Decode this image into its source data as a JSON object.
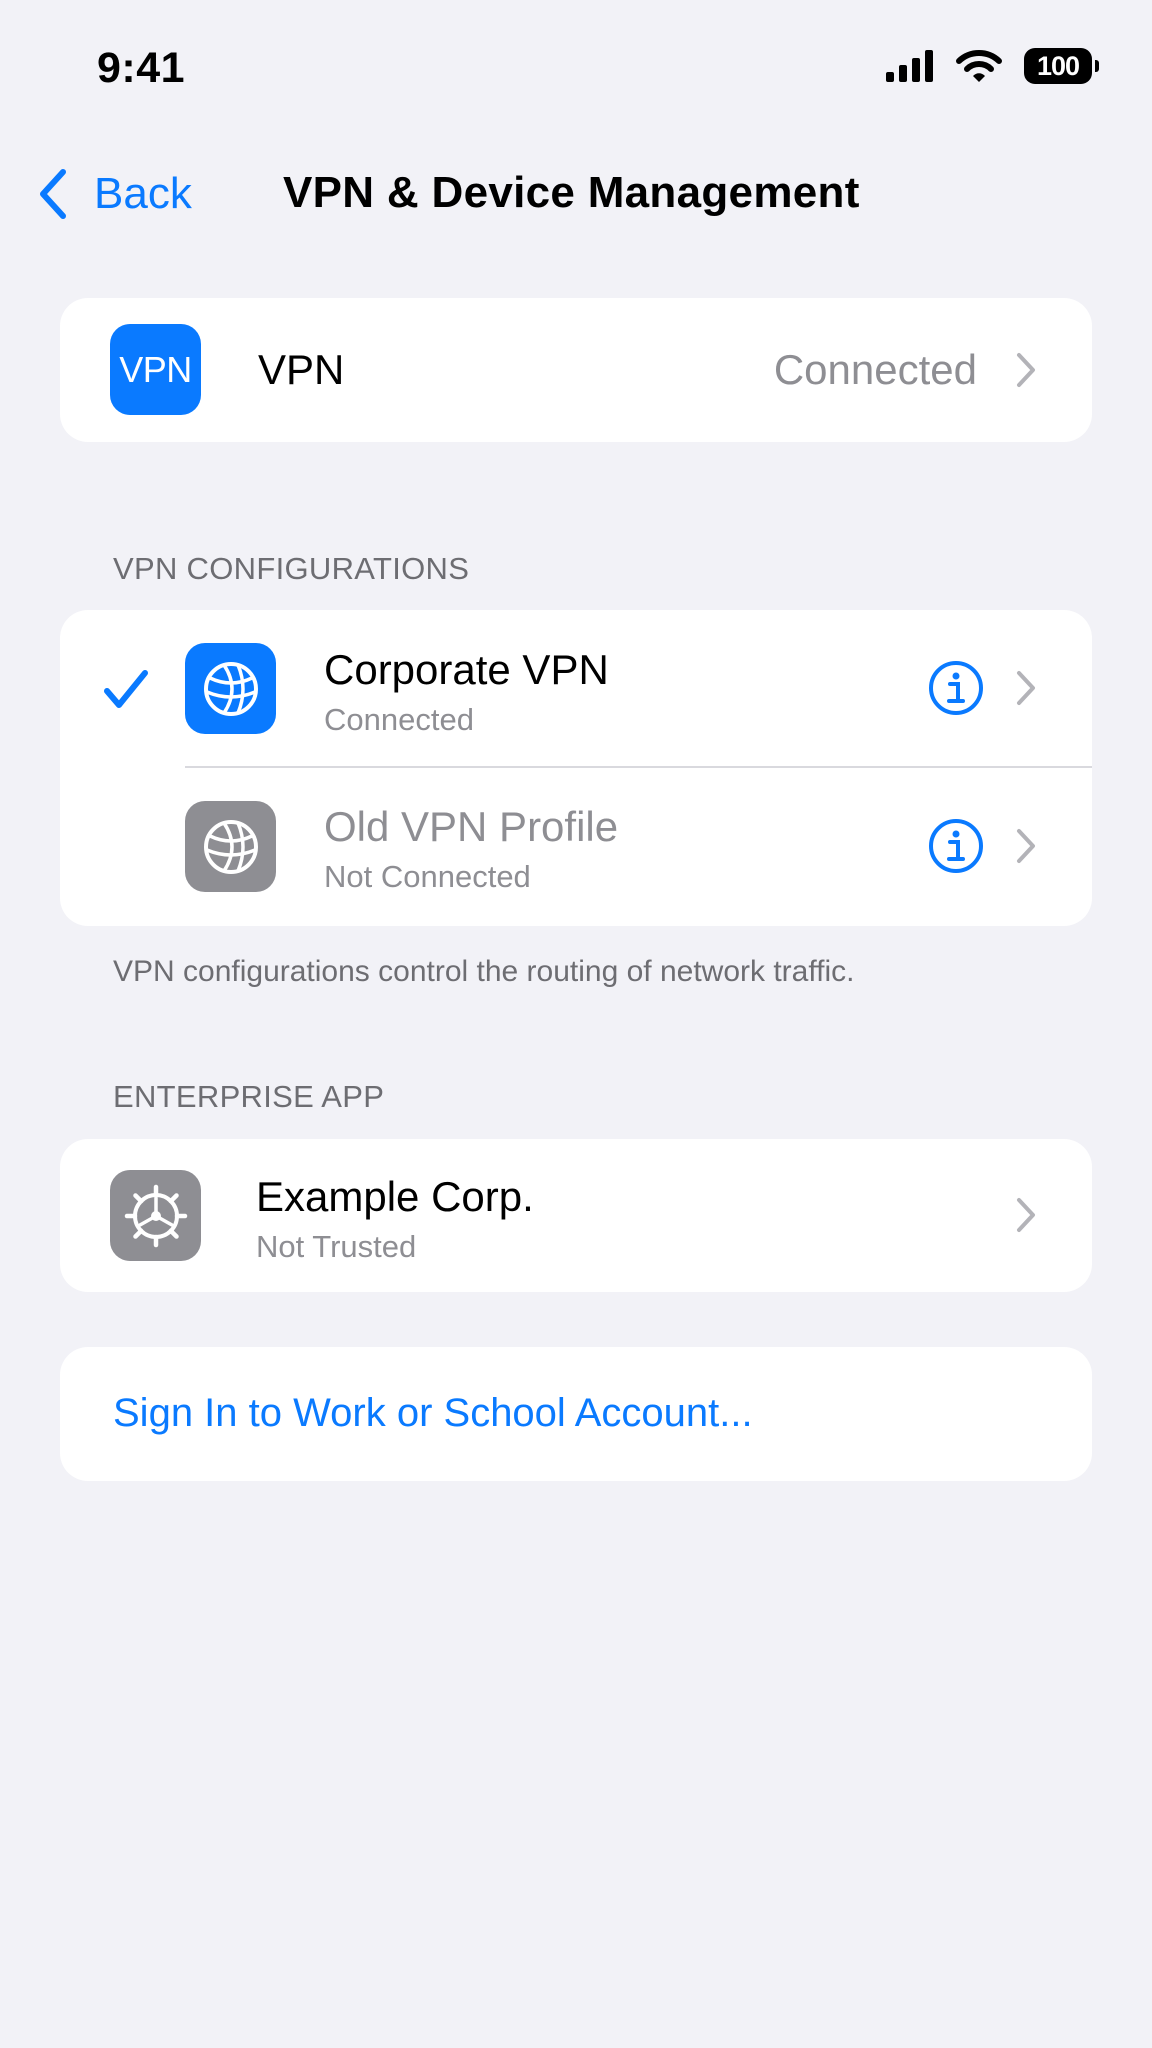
{
  "status_bar": {
    "time": "9:41",
    "battery_level": "100",
    "signal_icon": "cellular-signal-icon",
    "wifi_icon": "wifi-icon"
  },
  "nav": {
    "back_label": "Back",
    "title": "VPN & Device Management"
  },
  "vpn_row": {
    "icon_text": "VPN",
    "label": "VPN",
    "status": "Connected"
  },
  "vpn_configurations": {
    "header": "VPN CONFIGURATIONS",
    "items": [
      {
        "name": "Corporate VPN",
        "status": "Connected",
        "selected": true
      },
      {
        "name": "Old VPN Profile",
        "status": "Not Connected",
        "selected": false
      }
    ],
    "footer": "VPN configurations control the routing of network traffic."
  },
  "enterprise_app": {
    "header": "ENTERPRISE APP",
    "name": "Example Corp.",
    "status": "Not Trusted"
  },
  "sign_in": {
    "label": "Sign In to Work or School Account..."
  },
  "colors": {
    "accent": "#0a7aff",
    "background": "#f2f2f7",
    "secondary_text": "#8e8e93"
  }
}
